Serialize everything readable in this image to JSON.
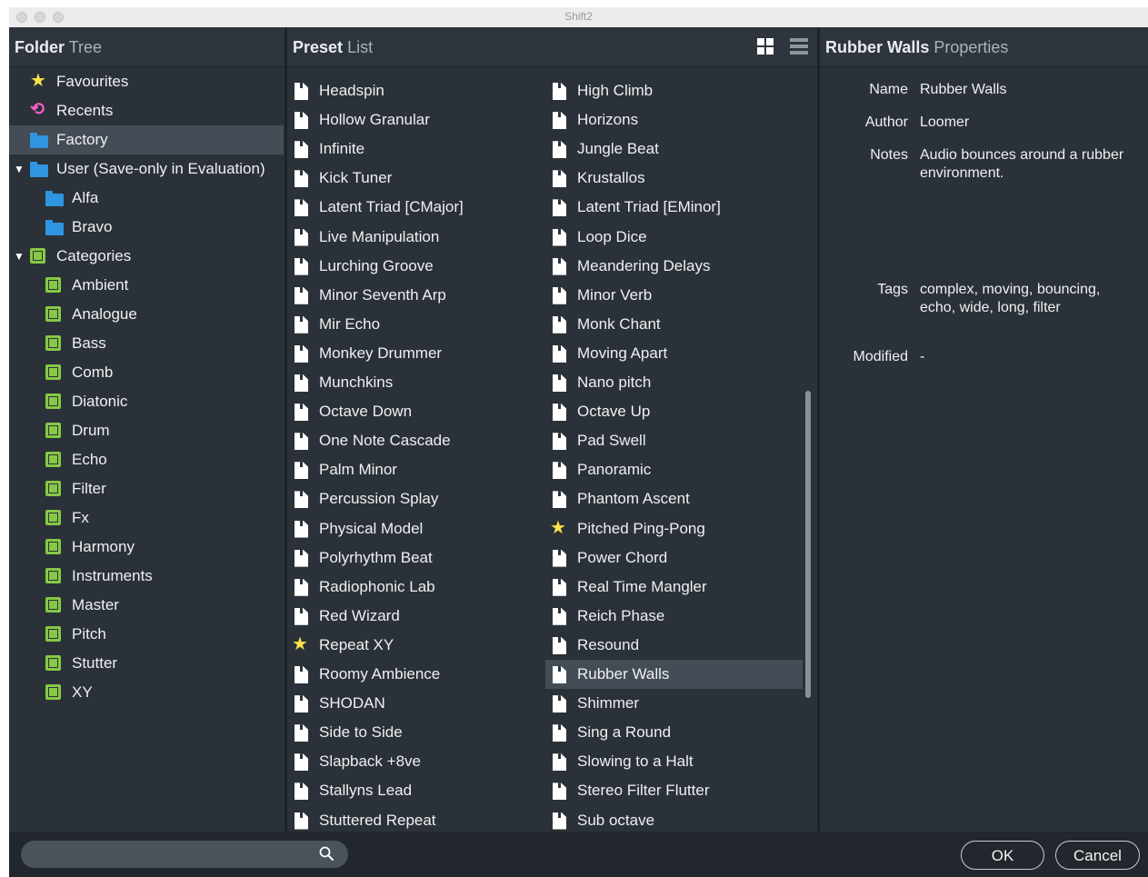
{
  "window": {
    "title": "Shift2"
  },
  "folder_tree": {
    "header_bold": "Folder",
    "header_light": "Tree",
    "items": [
      {
        "label": "Favourites",
        "icon": "star-icon"
      },
      {
        "label": "Recents",
        "icon": "recents-icon"
      },
      {
        "label": "Factory",
        "icon": "folder-icon",
        "selected": true
      },
      {
        "label": "User (Save-only in Evaluation)",
        "icon": "folder-icon",
        "expanded": true
      },
      {
        "label": "Alfa",
        "icon": "folder-icon"
      },
      {
        "label": "Bravo",
        "icon": "folder-icon"
      },
      {
        "label": "Categories",
        "icon": "category-icon",
        "expanded": true
      },
      {
        "label": "Ambient",
        "icon": "category-icon"
      },
      {
        "label": "Analogue",
        "icon": "category-icon"
      },
      {
        "label": "Bass",
        "icon": "category-icon"
      },
      {
        "label": "Comb",
        "icon": "category-icon"
      },
      {
        "label": "Diatonic",
        "icon": "category-icon"
      },
      {
        "label": "Drum",
        "icon": "category-icon"
      },
      {
        "label": "Echo",
        "icon": "category-icon"
      },
      {
        "label": "Filter",
        "icon": "category-icon"
      },
      {
        "label": "Fx",
        "icon": "category-icon"
      },
      {
        "label": "Harmony",
        "icon": "category-icon"
      },
      {
        "label": "Instruments",
        "icon": "category-icon"
      },
      {
        "label": "Master",
        "icon": "category-icon"
      },
      {
        "label": "Pitch",
        "icon": "category-icon"
      },
      {
        "label": "Stutter",
        "icon": "category-icon"
      },
      {
        "label": "XY",
        "icon": "category-icon"
      }
    ]
  },
  "preset_list": {
    "header_bold": "Preset",
    "header_light": "List",
    "column_left": [
      {
        "label": "Headspin"
      },
      {
        "label": "Hollow Granular"
      },
      {
        "label": "Infinite"
      },
      {
        "label": "Kick Tuner"
      },
      {
        "label": "Latent Triad [CMajor]"
      },
      {
        "label": "Live Manipulation"
      },
      {
        "label": "Lurching Groove"
      },
      {
        "label": "Minor Seventh Arp"
      },
      {
        "label": "Mir Echo"
      },
      {
        "label": "Monkey Drummer"
      },
      {
        "label": "Munchkins"
      },
      {
        "label": "Octave Down"
      },
      {
        "label": "One Note Cascade"
      },
      {
        "label": "Palm Minor"
      },
      {
        "label": "Percussion Splay"
      },
      {
        "label": "Physical Model"
      },
      {
        "label": "Polyrhythm Beat"
      },
      {
        "label": "Radiophonic Lab"
      },
      {
        "label": "Red Wizard"
      },
      {
        "label": "Repeat XY",
        "favourite": true
      },
      {
        "label": "Roomy Ambience"
      },
      {
        "label": "SHODAN"
      },
      {
        "label": "Side to Side"
      },
      {
        "label": "Slapback +8ve"
      },
      {
        "label": "Stallyns Lead"
      },
      {
        "label": "Stuttered Repeat"
      }
    ],
    "column_right": [
      {
        "label": "High Climb"
      },
      {
        "label": "Horizons"
      },
      {
        "label": "Jungle Beat"
      },
      {
        "label": "Krustallos"
      },
      {
        "label": "Latent Triad [EMinor]"
      },
      {
        "label": "Loop Dice"
      },
      {
        "label": "Meandering Delays"
      },
      {
        "label": "Minor Verb"
      },
      {
        "label": "Monk Chant"
      },
      {
        "label": "Moving Apart"
      },
      {
        "label": "Nano pitch"
      },
      {
        "label": "Octave Up"
      },
      {
        "label": "Pad Swell"
      },
      {
        "label": "Panoramic"
      },
      {
        "label": "Phantom Ascent"
      },
      {
        "label": "Pitched Ping-Pong",
        "favourite": true
      },
      {
        "label": "Power Chord"
      },
      {
        "label": "Real Time Mangler"
      },
      {
        "label": "Reich Phase"
      },
      {
        "label": "Resound"
      },
      {
        "label": "Rubber Walls",
        "selected": true
      },
      {
        "label": "Shimmer"
      },
      {
        "label": "Sing a Round"
      },
      {
        "label": "Slowing to a Halt"
      },
      {
        "label": "Stereo Filter Flutter"
      },
      {
        "label": "Sub octave"
      }
    ]
  },
  "properties": {
    "header_bold": "Rubber Walls",
    "header_light": "Properties",
    "name_key": "Name",
    "name_val": "Rubber Walls",
    "author_key": "Author",
    "author_val": "Loomer",
    "notes_key": "Notes",
    "notes_val": "Audio bounces around a rubber environment.",
    "tags_key": "Tags",
    "tags_val": "complex, moving, bouncing, echo, wide, long, filter",
    "modified_key": "Modified",
    "modified_val": "-"
  },
  "footer": {
    "search_placeholder": "",
    "ok_label": "OK",
    "cancel_label": "Cancel"
  },
  "colors": {
    "background": "#2b3138",
    "folder": "#2f95e0",
    "category": "#86c944",
    "star": "#f7e24a",
    "recents": "#f35ec4",
    "selection": "#444c55"
  }
}
